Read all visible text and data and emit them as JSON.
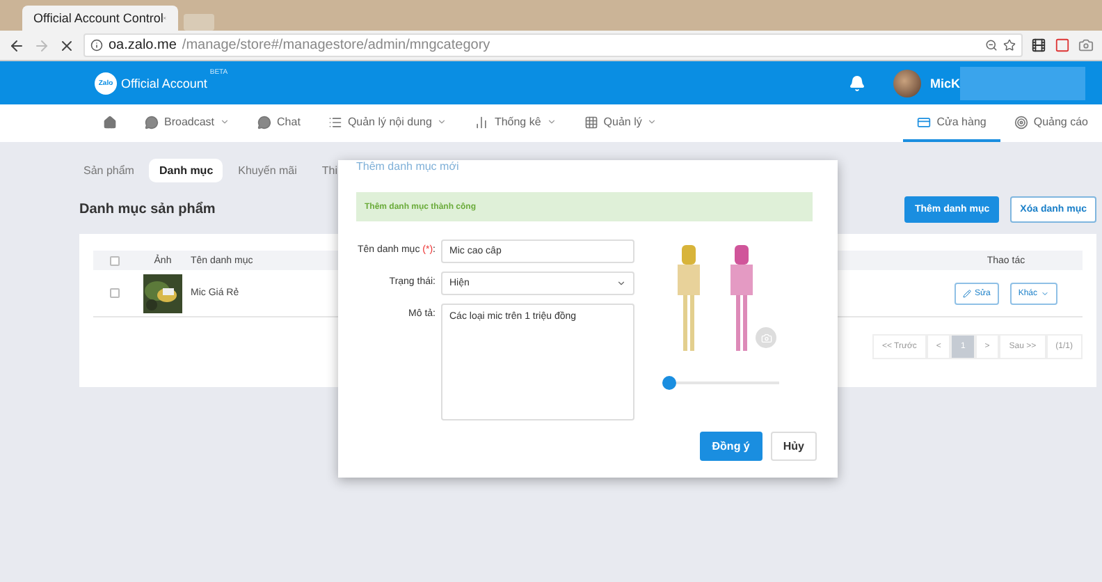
{
  "browser": {
    "tab_title": "Official Account Control",
    "url_host": "oa.zalo.me",
    "url_path": "/manage/store#/managestore/admin/mngcategory"
  },
  "header": {
    "logo": "Zalo",
    "brand": "Official Account",
    "badge": "BETA",
    "user": "MicK"
  },
  "nav": [
    {
      "kind": "home",
      "dropdown": false,
      "selected": false
    },
    {
      "kind": "chat",
      "label": "Broadcast",
      "dropdown": true,
      "selected": false
    },
    {
      "kind": "chat",
      "label": "Chat",
      "dropdown": false,
      "selected": false
    },
    {
      "kind": "list",
      "label": "Quản lý nội dung",
      "dropdown": true,
      "selected": false
    },
    {
      "kind": "chart",
      "label": "Thống kê",
      "dropdown": true,
      "selected": false
    },
    {
      "kind": "grid",
      "label": "Quản lý",
      "dropdown": true,
      "selected": false
    },
    {
      "kind": "store",
      "label": "Cửa hàng",
      "dropdown": false,
      "selected": true
    },
    {
      "kind": "ads",
      "label": "Quảng cáo",
      "dropdown": false,
      "selected": false
    }
  ],
  "subtabs": [
    {
      "label": "Sản phẩm",
      "selected": false
    },
    {
      "label": "Danh mục",
      "selected": true
    },
    {
      "label": "Khuyến mãi",
      "selected": false
    },
    {
      "label": "Thi",
      "selected": false
    }
  ],
  "page_title": "Danh mục sản phẩm",
  "actions": [
    {
      "label": "Thêm danh mục",
      "kind": "primary"
    },
    {
      "label": "Xóa danh mục",
      "kind": "outline"
    }
  ],
  "table": {
    "columns": [
      "Ảnh",
      "Tên danh mục",
      "Thao tác"
    ],
    "select_all_checked": false,
    "rows": [
      {
        "checked": false,
        "name": "Mic Giá Rẻ",
        "actions": [
          "Sửa",
          "Khác"
        ]
      }
    ]
  },
  "pagination": [
    {
      "label": "<< Trước",
      "selected": false
    },
    {
      "label": "<",
      "selected": false
    },
    {
      "label": "1",
      "selected": true
    },
    {
      "label": ">",
      "selected": false
    },
    {
      "label": "Sau >>",
      "selected": false
    },
    {
      "label": "(1/1)",
      "selected": false
    }
  ],
  "modal": {
    "title": "Thêm danh mục mới",
    "alert": "Thêm danh mục thành công",
    "fields": [
      {
        "kind": "input",
        "label": "Tên danh mục",
        "required": "(*)",
        "after": ":",
        "value": "Mic cao cấp"
      },
      {
        "kind": "select",
        "label": "Trạng thái:",
        "value": "Hiện"
      },
      {
        "kind": "textarea",
        "label": "Mô tả:",
        "value": "Các loại mic trên 1 triệu đồng"
      }
    ],
    "slider": {
      "level": 0
    },
    "buttons": [
      {
        "label": "Đồng ý",
        "kind": "primary"
      },
      {
        "label": "Hủy",
        "kind": "outline"
      }
    ]
  }
}
